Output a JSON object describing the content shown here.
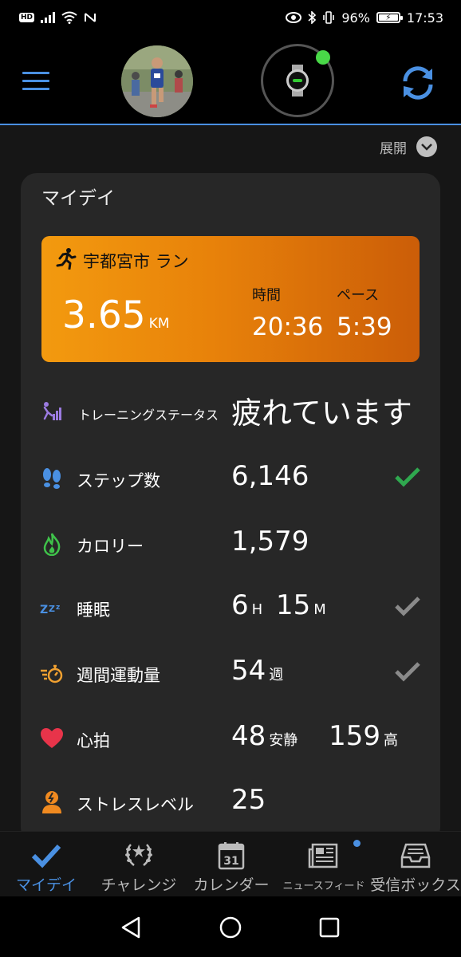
{
  "status_bar": {
    "hd": "HD",
    "battery": "96%",
    "time": "17:53"
  },
  "header": {
    "expand_label": "展開"
  },
  "my_day": {
    "title": "マイデイ",
    "activity": {
      "name": "宇都宮市 ラン",
      "distance": "3.65",
      "distance_unit": "KM",
      "time_label": "時間",
      "time_value": "20:36",
      "pace_label": "ペース",
      "pace_value": "5:39"
    },
    "stats": {
      "training_status": {
        "label": "トレーニングステータス",
        "value": "疲れています"
      },
      "steps": {
        "label": "ステップ数",
        "value": "6,146"
      },
      "calories": {
        "label": "カロリー",
        "value": "1,579"
      },
      "sleep": {
        "label": "睡眠",
        "hours": "6",
        "h_unit": "H",
        "minutes": "15",
        "m_unit": "M"
      },
      "intensity": {
        "label": "週間運動量",
        "value": "54",
        "unit": "週"
      },
      "heart_rate": {
        "label": "心拍",
        "resting": "48",
        "resting_unit": "安静",
        "high": "159",
        "high_unit": "高"
      },
      "stress": {
        "label": "ストレスレベル",
        "value": "25"
      }
    }
  },
  "bottom_nav": [
    {
      "label": "マイデイ",
      "icon": "check-icon",
      "active": true
    },
    {
      "label": "チャレンジ",
      "icon": "laurel-icon",
      "active": false
    },
    {
      "label": "カレンダー",
      "icon": "calendar-icon",
      "calendar_day": "31",
      "active": false
    },
    {
      "label": "ニュースフィード",
      "icon": "newsfeed-icon",
      "active": false
    },
    {
      "label": "受信ボックス",
      "icon": "inbox-icon",
      "active": false
    }
  ],
  "colors": {
    "accent": "#4a90e2",
    "activity_gradient_start": "#f39a0f",
    "activity_gradient_end": "#cb5d08",
    "check_green": "#2fa84f",
    "check_gray": "#8a8a8a"
  }
}
